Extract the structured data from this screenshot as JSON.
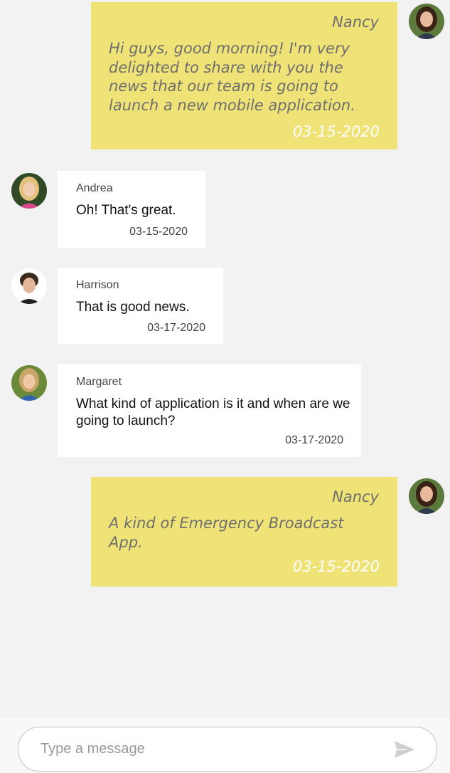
{
  "messages": [
    {
      "sender": "Nancy",
      "text": "Hi guys, good morning! I'm very delighted to share with you the news that our team is going to launch a new mobile application.",
      "time": "03-15-2020",
      "avatar": "nancy-avatar"
    },
    {
      "sender": "Andrea",
      "text": "Oh! That's great.",
      "time": "03-15-2020",
      "avatar": "andrea-avatar"
    },
    {
      "sender": "Harrison",
      "text": "That is good news.",
      "time": "03-17-2020",
      "avatar": "harrison-avatar"
    },
    {
      "sender": "Margaret",
      "text": "What kind of application is it and when are we going to launch?",
      "time": "03-17-2020",
      "avatar": "margaret-avatar"
    },
    {
      "sender": "Nancy",
      "text": "A kind of Emergency Broadcast App.",
      "time": "03-15-2020",
      "avatar": "nancy-avatar"
    }
  ],
  "compose": {
    "placeholder": "Type a message",
    "send_icon": "send-icon"
  },
  "colors": {
    "outgoing_bubble": "#efe276",
    "incoming_bubble": "#ffffff",
    "background": "#f2f2f2"
  }
}
